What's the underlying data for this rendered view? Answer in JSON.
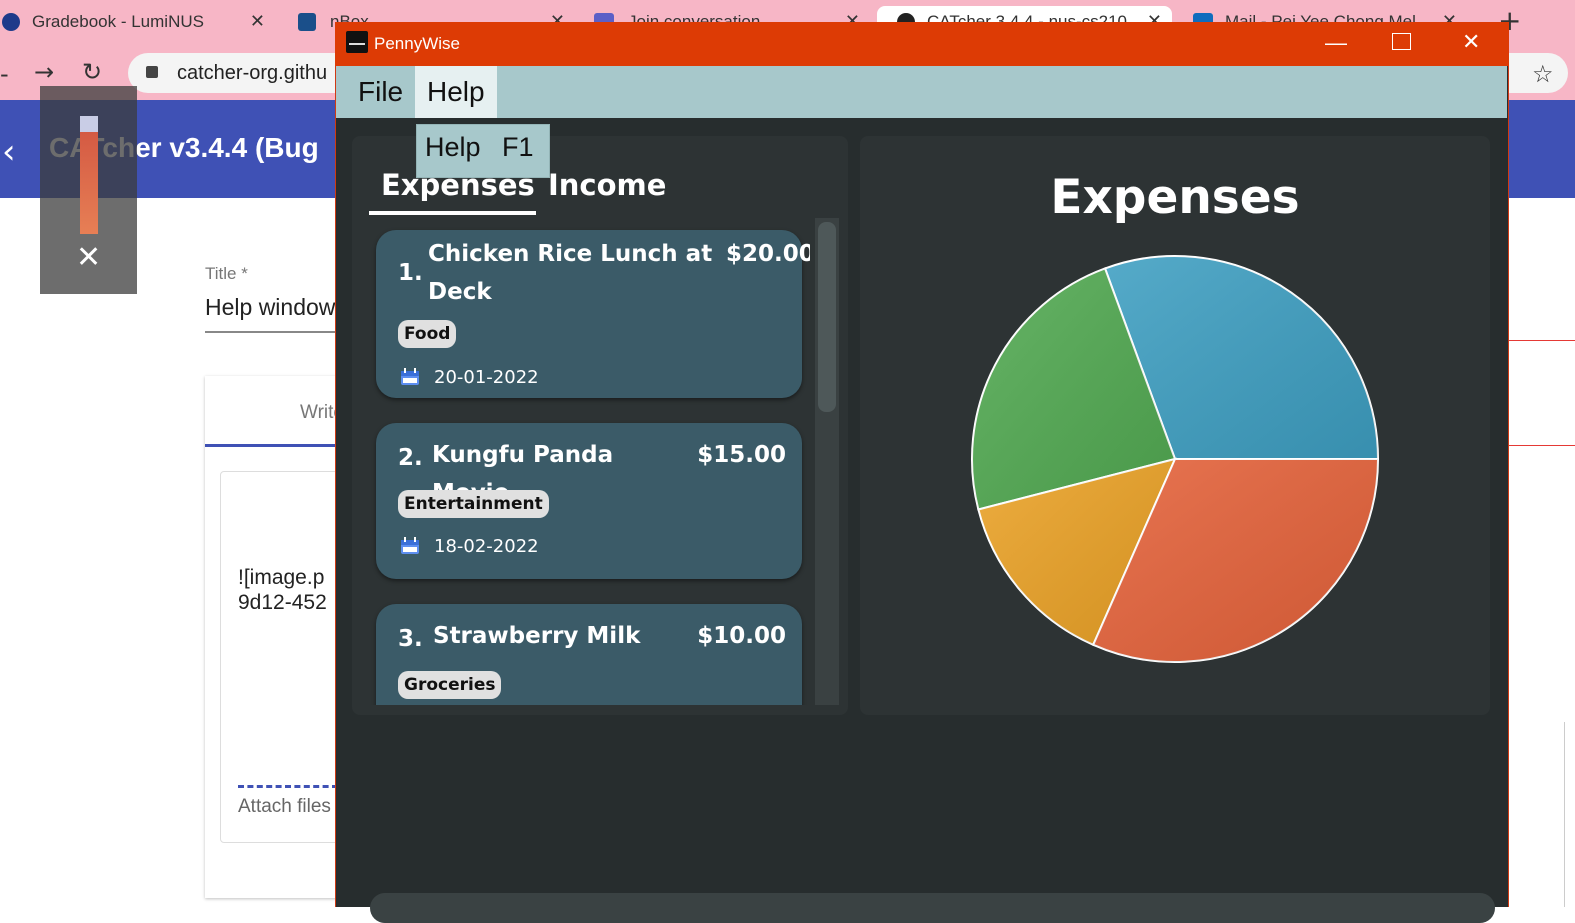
{
  "browser": {
    "tabs": [
      {
        "label": "Gradebook - LumiNUS"
      },
      {
        "label": "nBox"
      },
      {
        "label": "Join conversation"
      },
      {
        "label": "CATcher 3.4.4 - nus-cs210"
      },
      {
        "label": "Mail - Pei Yee Chong Mel"
      }
    ],
    "url": "catcher-org.githu",
    "new_tab_glyph": "+",
    "close_glyph": "✕"
  },
  "catcher": {
    "title": "CATcher v3.4.4  (Bug",
    "title_label": "Title *",
    "title_value": "Help window",
    "write_tab": "Write",
    "markdown_line1": "![image.p",
    "markdown_line2": "9d12-452",
    "attach_label": "Attach files"
  },
  "app": {
    "window_title": "PennyWise",
    "menu": {
      "file": "File",
      "help": "Help"
    },
    "help_dropdown": {
      "label": "Help",
      "shortcut": "F1"
    },
    "tabs": {
      "expenses": "Expenses",
      "income": "Income"
    },
    "expenses": [
      {
        "index": "1.",
        "description": "Chicken Rice Lunch at Deck",
        "amount": "$20.00",
        "category": "Food",
        "date": "20-01-2022"
      },
      {
        "index": "2.",
        "description": "Kungfu Panda Movie",
        "amount": "$15.00",
        "category": "Entertainment",
        "date": "18-02-2022"
      },
      {
        "index": "3.",
        "description": "Strawberry Milk",
        "amount": "$10.00",
        "category": "Groceries",
        "date": ""
      }
    ]
  },
  "chart_data": {
    "type": "pie",
    "title": "Expenses",
    "values": [
      30.6,
      31.6,
      14.4,
      23.4
    ],
    "colors": [
      "#3e9fc2",
      "#e5623a",
      "#eba226",
      "#52aa52"
    ]
  }
}
